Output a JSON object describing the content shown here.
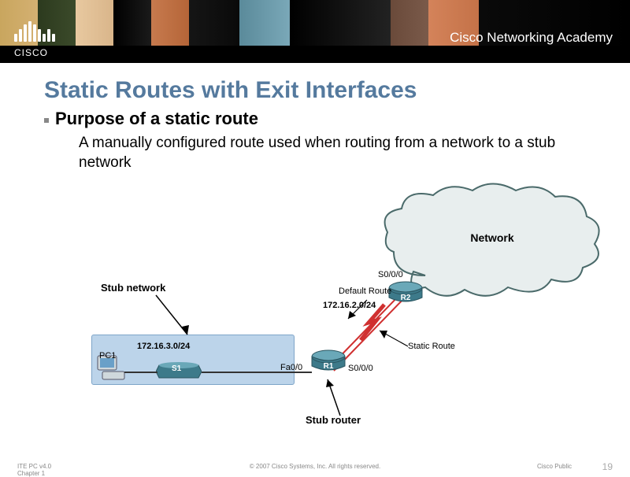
{
  "header": {
    "brand": "CISCO",
    "academy": "Cisco Networking Academy"
  },
  "slide": {
    "title": "Static Routes with Exit Interfaces",
    "subtitle": "Purpose of a static route",
    "body": "A manually configured route used when routing from a network to a stub network"
  },
  "diagram": {
    "cloud_label": "Network",
    "stub_network_label": "Stub network",
    "stub_router_label": "Stub router",
    "stub_subnet": "172.16.3.0/24",
    "link_subnet": "172.16.2.0/24",
    "default_route_label": "Default Route",
    "static_route_label": "Static Route",
    "pc_label": "PC1",
    "switch_label": "S1",
    "router1_label": "R1",
    "router2_label": "R2",
    "r1_fa": "Fa0/0",
    "r1_s0": "S0/0/0",
    "r2_s0": "S0/0/0"
  },
  "footer": {
    "left1": "ITE PC v4.0",
    "left2": "Chapter 1",
    "center": "© 2007 Cisco Systems, Inc. All rights reserved.",
    "right": "Cisco Public",
    "page": "19"
  }
}
